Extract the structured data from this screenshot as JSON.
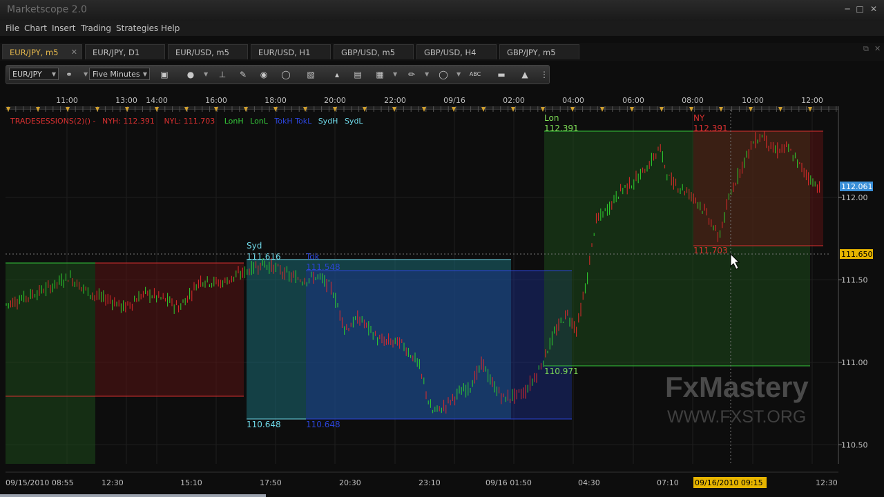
{
  "window": {
    "title": "Marketscope 2.0"
  },
  "menu": [
    "File",
    "Chart",
    "Insert",
    "Trading",
    "Strategies",
    "Help"
  ],
  "tabs": [
    {
      "label": "EUR/JPY, m5",
      "active": true,
      "closable": true
    },
    {
      "label": "EUR/JPY, D1"
    },
    {
      "label": "EUR/USD, m5"
    },
    {
      "label": "EUR/USD, H1"
    },
    {
      "label": "GBP/USD, m5"
    },
    {
      "label": "GBP/USD, H4"
    },
    {
      "label": "GBP/JPY, m5"
    }
  ],
  "toolbar": {
    "instrument": "EUR/JPY",
    "timeframe": "Five Minutes",
    "tools": [
      "cursor-icon",
      "crosshair-icon",
      "trendline-icon",
      "label-icon",
      "eye-icon",
      "globe-icon",
      "ruler-icon",
      "chart-type-icon",
      "template-icon",
      "indicator-icon",
      "pencil-icon",
      "ellipse-icon",
      "abc-text-icon",
      "eraser-icon",
      "tree-icon"
    ]
  },
  "chart": {
    "top_times": [
      "11:00",
      "13:00",
      "14:00",
      "16:00",
      "18:00",
      "20:00",
      "22:00",
      "09/16",
      "02:00",
      "04:00",
      "06:00",
      "08:00",
      "10:00",
      "12:00"
    ],
    "bottom_times": [
      "09/15/2010 08:55",
      "12:30",
      "15:10",
      "17:50",
      "20:30",
      "23:10",
      "09/16 01:50",
      "04:30",
      "07:10",
      "09/16/2010 09:15",
      "12:30"
    ],
    "price_ticks": [
      "112.00",
      "111.50",
      "111.00",
      "110.50"
    ],
    "legend": {
      "prefix": "TRADESESSIONS(2)() -",
      "nyh": "NYH: 112.391",
      "nyl": "NYL: 111.703",
      "lonh": "LonH",
      "lonl": "LonL",
      "tokyo": "TokH TokL",
      "sydh": "SydH",
      "sydl": "SydL"
    },
    "sessions": {
      "syd_name": "Syd",
      "syd_high": "111.616",
      "syd_low": "110.648",
      "tok_name": "Tok",
      "tok_high": "111.548",
      "tok_low": "110.648",
      "lon_name": "Lon",
      "lon_high": "112.391",
      "lon_low": "110.971",
      "ny_name": "NY",
      "ny_high": "112.391",
      "ny_low": "111.703"
    },
    "last_price": "112.061",
    "cursor_price": "111.650",
    "cursor_time": "09/16/2010 09:15",
    "watermark": {
      "title": "FxMastery",
      "url": "WWW.FXST.ORG"
    },
    "colors": {
      "green": "#35c83a",
      "red": "#d93030",
      "cyan": "#6fd8e8",
      "blue": "#2b44d8",
      "lime_text": "#7fdf57"
    }
  }
}
